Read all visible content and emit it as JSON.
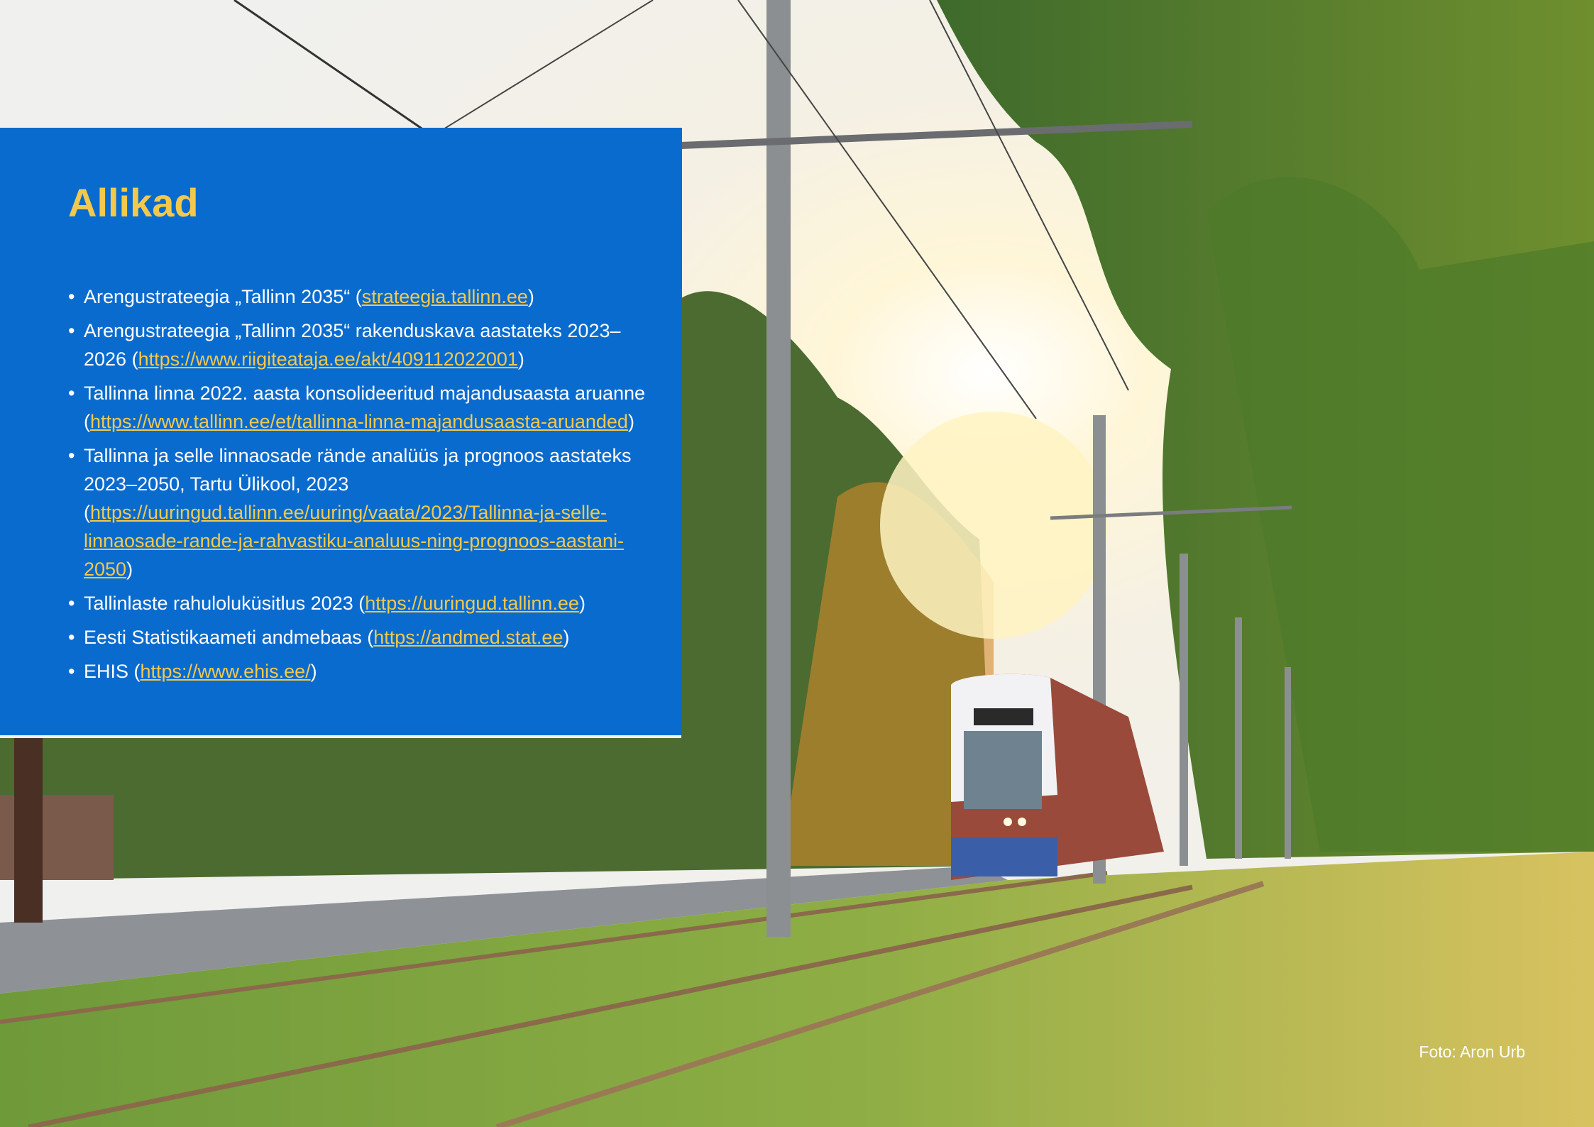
{
  "panel": {
    "title": "Allikad",
    "items": [
      {
        "pre": "Arengustrateegia „Tallinn 2035“ (",
        "link": "strateegia.tallinn.ee",
        "post": ")"
      },
      {
        "pre": "Arengustrateegia „Tallinn 2035“ rakenduskava aastateks 2023–2026 (",
        "link": "https://www.riigiteataja.ee/akt/409112022001",
        "post": ")"
      },
      {
        "pre": "Tallinna linna 2022. aasta konsolideeritud majandusaasta aruanne (",
        "link": "https://www.tallinn.ee/et/tallinna-linna-majandusaasta-aruanded",
        "post": ")"
      },
      {
        "pre": "Tallinna ja selle linnaosade rände analüüs ja prognoos aastateks 2023–2050, Tartu Ülikool, 2023 (",
        "link": "https://uuringud.tallinn.ee/uuring/vaata/2023/Tallinna-ja-selle-linnaosade-rande-ja-rahvastiku-analuus-ning-prognoos-aastani-2050",
        "post": ")"
      },
      {
        "pre": "Tallinlaste rahuloluküsitlus 2023 (",
        "link": "https://uuringud.tallinn.ee",
        "post": ")"
      },
      {
        "pre": "Eesti Statistikaameti andmebaas (",
        "link": "https://andmed.stat.ee",
        "post": ")"
      },
      {
        "pre": "EHIS (",
        "link": "https://www.ehis.ee/",
        "post": ")"
      }
    ],
    "bullet": "•"
  },
  "credit": "Foto: Aron Urb",
  "colors": {
    "panel": "#0a6bcf",
    "accent": "#f2c94c",
    "text": "#ffffff"
  }
}
